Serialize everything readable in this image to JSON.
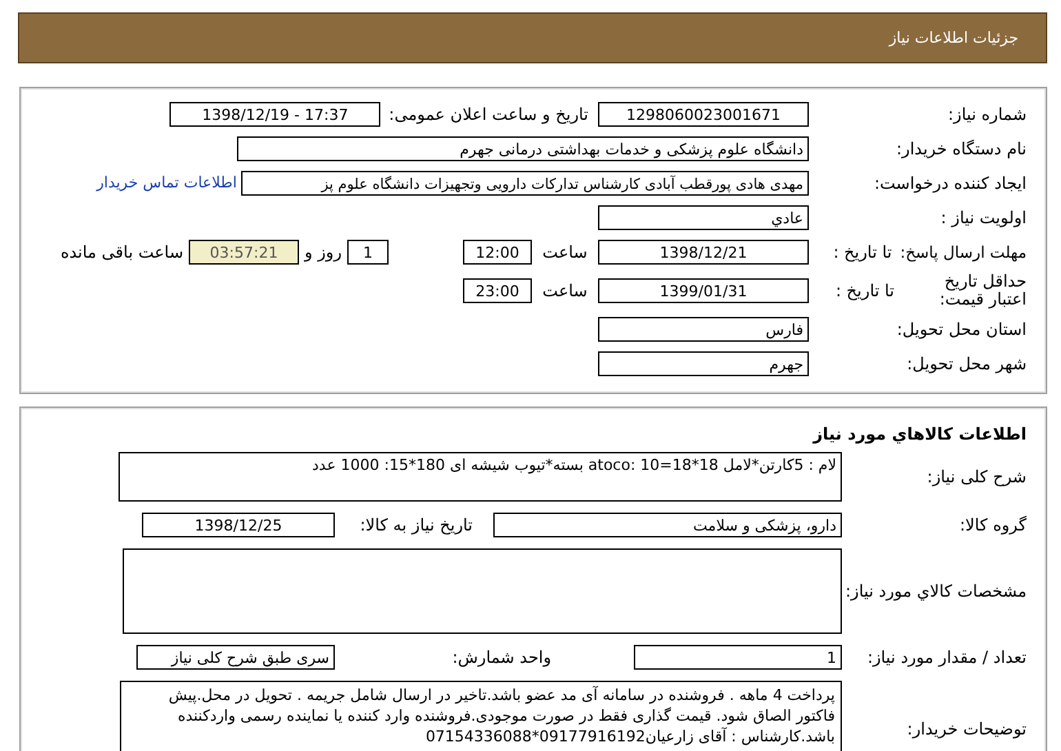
{
  "header": {
    "title": "جزئیات اطلاعات نیاز"
  },
  "need_info": {
    "need_number": {
      "label": "شماره نیاز:",
      "value": "1298060023001671"
    },
    "announce": {
      "label": "تاریخ و ساعت اعلان عمومی:",
      "value": "1398/12/19 - 17:37"
    },
    "buyer": {
      "label": "نام دستگاه خریدار:",
      "value": "دانشگاه علوم پزشکی و خدمات بهداشتی درمانی جهرم"
    },
    "creator": {
      "label": "ایجاد کننده درخواست:",
      "value": "مهدی هادی پورقطب آبادی کارشناس تدارکات دارویی وتجهیزات دانشگاه علوم پز",
      "contact_link": "اطلاعات تماس خریدار"
    },
    "priority": {
      "label": "اولویت نیاز :",
      "value": "عادي"
    },
    "deadline": {
      "label": "مهلت ارسال پاسخ:",
      "sublabel": "تا تاریخ :",
      "date": "1398/12/21",
      "time_label": "ساعت",
      "time": "12:00",
      "days": "1",
      "days_label": "روز و",
      "remaining": "03:57:21",
      "remaining_label": "ساعت باقی مانده"
    },
    "validity": {
      "label": "حداقل تاریخ اعتبار قیمت:",
      "sublabel": "تا تاریخ :",
      "date": "1399/01/31",
      "time_label": "ساعت",
      "time": "23:00"
    },
    "province": {
      "label": "استان محل تحویل:",
      "value": "فارس"
    },
    "city": {
      "label": "شهر محل تحویل:",
      "value": "جهرم"
    }
  },
  "goods": {
    "title": "اطلاعات کالاهاي مورد نیاز",
    "description": {
      "label": "شرح کلی نیاز:",
      "value": "لام : 5کارتن*لامل 18*18=10 :atoco بسته*تیوب  شیشه ای 180*15: 1000 عدد"
    },
    "group": {
      "label": "گروه کالا:",
      "value": "دارو، پزشکی و سلامت",
      "date_label": "تاریخ نیاز به کالا:",
      "date": "1398/12/25"
    },
    "specs": {
      "label": "مشخصات کالاي مورد نیاز:"
    },
    "quantity": {
      "label": "تعداد / مقدار مورد نیاز:",
      "value": "1",
      "unit_label": "واحد شمارش:",
      "unit": "سری طبق شرح کلی نیاز"
    },
    "notes": {
      "label": "توضیحات خریدار:",
      "value": "پرداخت 4 ماهه . فروشنده در سامانه آی مد عضو باشد.تاخیر در ارسال شامل جریمه  . تحویل در محل.پیش فاکتور الصاق شود. قیمت گذاری فقط در صورت موجودی.فروشنده وارد کننده یا نماینده رسمی واردکننده باشد.کارشناس : آقای زارعیان09177916192*07154336088"
    }
  }
}
